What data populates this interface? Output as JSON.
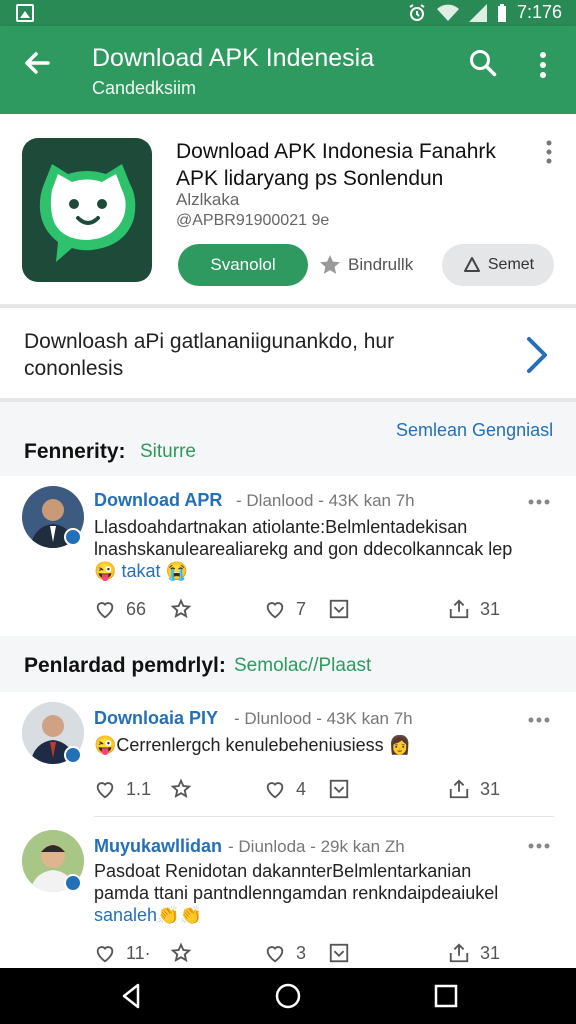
{
  "status_bar": {
    "time": "7:176",
    "icons": [
      "gallery-icon",
      "alarm-icon",
      "wifi-icon",
      "signal-icon",
      "battery-icon"
    ]
  },
  "app_bar": {
    "title": "Download APK Indenesia",
    "subtitle": "Candedksiim"
  },
  "app": {
    "name": "Download APK Indonesia Fanahrk APK  lidaryang ps Sonlendun",
    "developer": "Alzlkaka",
    "package": "@APBR91900021 9e",
    "install_label": "Svanolol",
    "bookmark_label": "Bindrullk",
    "share_label": "Semet"
  },
  "description": {
    "text": "Downloash aPi gatlananiigunankdo, hur cononlesis"
  },
  "section1": {
    "title": "Fennerity:",
    "accent": "Siturre",
    "link": "Semlean Gengniasl"
  },
  "section2": {
    "title": "Penlardad pemdrlyl:",
    "accent": "Semolac//Plaast"
  },
  "posts": [
    {
      "author": "Download APR",
      "meta": "- Dlanlood - 43K kan 7h",
      "body": "Llasdoahdartnakan atiolante:Belmlentadekisan lnashskanulearealiarekg and gon ddecolkanncak lep",
      "tail": "takat",
      "likes": "66",
      "comments": "7",
      "shares": "31"
    },
    {
      "author": "Downloaia PIY",
      "meta": "- Dlunlood - 43K kan 7h",
      "body": "Cerrenlergch kenulebeheniusiess",
      "tail": "",
      "likes": "1.1",
      "comments": "4",
      "shares": "31"
    },
    {
      "author": "Muyukawllidan",
      "meta": "- Diunloda - 29k kan Zh",
      "body": "Pasdoat Renidotan dakannterBelmlentarkanian pamda ttani pantndlenngamdan renkndaipdeaiukel",
      "tail": "sanaleh",
      "likes": "11·",
      "comments": "3",
      "shares": "31"
    }
  ],
  "colors": {
    "primary": "#2e9a60",
    "primary_dark": "#2a8a55",
    "link": "#2470b8"
  }
}
